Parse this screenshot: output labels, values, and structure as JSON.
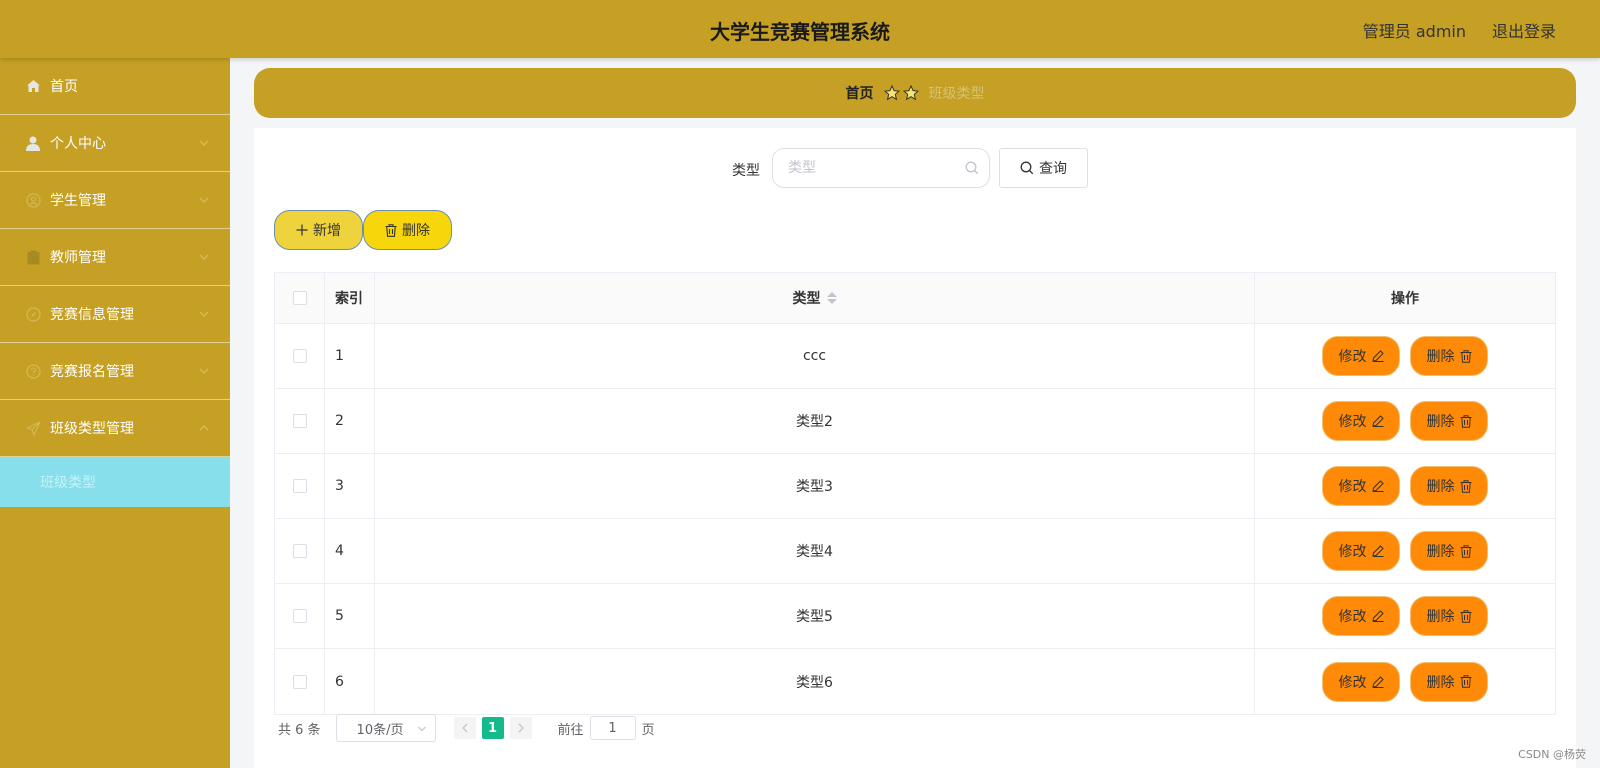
{
  "header": {
    "title": "大学生竞赛管理系统",
    "user": "管理员 admin",
    "logout": "退出登录"
  },
  "sidebar": {
    "items": [
      {
        "label": "首页",
        "icon": "home-icon"
      },
      {
        "label": "个人中心",
        "icon": "user-icon"
      },
      {
        "label": "学生管理",
        "icon": "student-icon"
      },
      {
        "label": "教师管理",
        "icon": "clipboard-icon"
      },
      {
        "label": "竞赛信息管理",
        "icon": "compass-icon"
      },
      {
        "label": "竞赛报名管理",
        "icon": "info-circle-icon"
      },
      {
        "label": "班级类型管理",
        "icon": "send-icon"
      }
    ],
    "subitem": "班级类型"
  },
  "breadcrumb": {
    "home": "首页",
    "current": "班级类型"
  },
  "search": {
    "label": "类型",
    "placeholder": "类型",
    "query_label": "查询"
  },
  "actions": {
    "add_label": "新增",
    "delete_label": "删除"
  },
  "table": {
    "headers": {
      "index": "索引",
      "type": "类型",
      "ops": "操作"
    },
    "rows": [
      {
        "index": "1",
        "type": "ccc"
      },
      {
        "index": "2",
        "type": "类型2"
      },
      {
        "index": "3",
        "type": "类型3"
      },
      {
        "index": "4",
        "type": "类型4"
      },
      {
        "index": "5",
        "type": "类型5"
      },
      {
        "index": "6",
        "type": "类型6"
      }
    ],
    "edit_label": "修改",
    "delete_label": "删除"
  },
  "pagination": {
    "total": "共 6 条",
    "page_size": "10条/页",
    "current_page": "1",
    "goto_prefix": "前往",
    "goto_value": "1",
    "goto_suffix": "页"
  },
  "watermark": "CSDN @杨荧",
  "colors": {
    "accent": "#c5a024",
    "submenu_active": "#86dfeb",
    "op_button": "#fe8a07",
    "add_button": "#efd33d",
    "delete_button": "#f7d70b",
    "page_active": "#13ba8a"
  }
}
